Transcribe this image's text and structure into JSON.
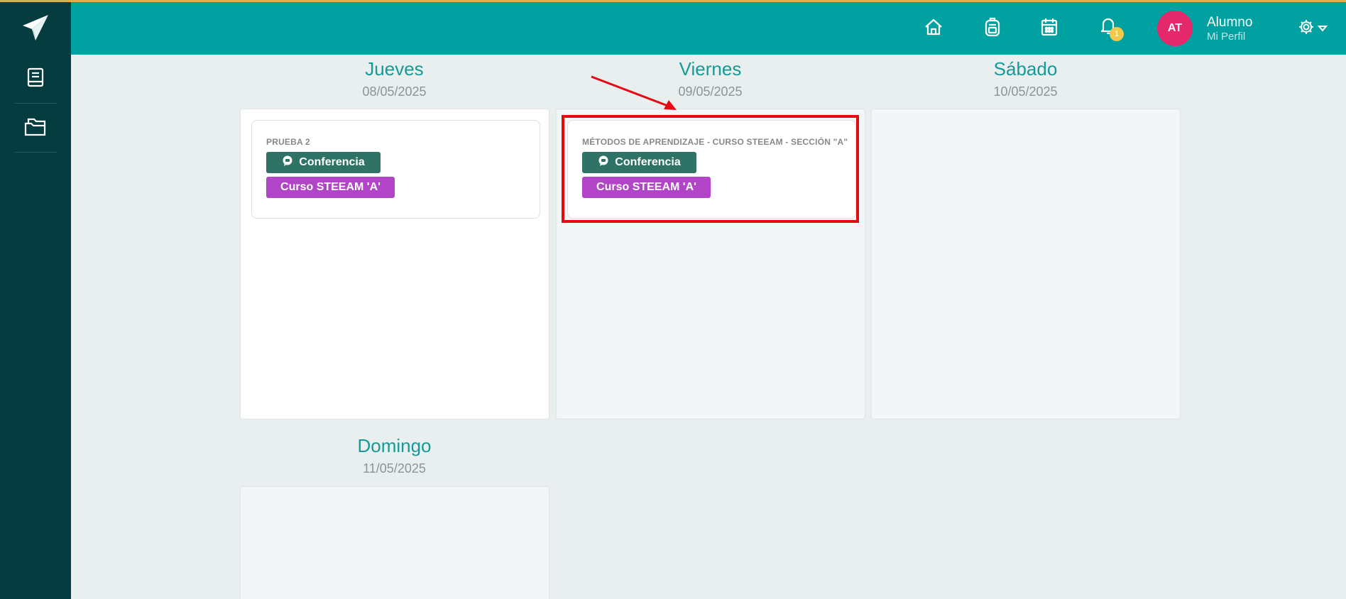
{
  "header": {
    "user_initials": "AT",
    "user_name": "Alumno",
    "user_subtitle": "Mi Perfil",
    "notification_count": "1"
  },
  "icons": {
    "logo": "paper-plane-icon",
    "sidebar": [
      "book-icon",
      "folders-icon"
    ],
    "topbar": [
      "home-icon",
      "backpack-icon",
      "calendar-icon",
      "bell-icon",
      "gear-icon"
    ]
  },
  "colors": {
    "topbar": "#00a1a0",
    "sidebar": "#043c40",
    "conference_tag": "#2f7367",
    "course_tag": "#b244c7",
    "highlight": "#e50914",
    "avatar": "#e5276c"
  },
  "calendar": {
    "days": [
      {
        "name": "Jueves",
        "date": "08/05/2025",
        "event": {
          "title": "PRUEBA 2",
          "type_label": "Conferencia",
          "course_label": "Curso STEEAM 'A'"
        }
      },
      {
        "name": "Viernes",
        "date": "09/05/2025",
        "event": {
          "title": "MÉTODOS DE APRENDIZAJE - CURSO STEEAM - SECCIÓN \"A\"",
          "type_label": "Conferencia",
          "course_label": "Curso STEEAM 'A'"
        }
      },
      {
        "name": "Sábado",
        "date": "10/05/2025"
      },
      {
        "name": "Domingo",
        "date": "11/05/2025"
      }
    ]
  }
}
